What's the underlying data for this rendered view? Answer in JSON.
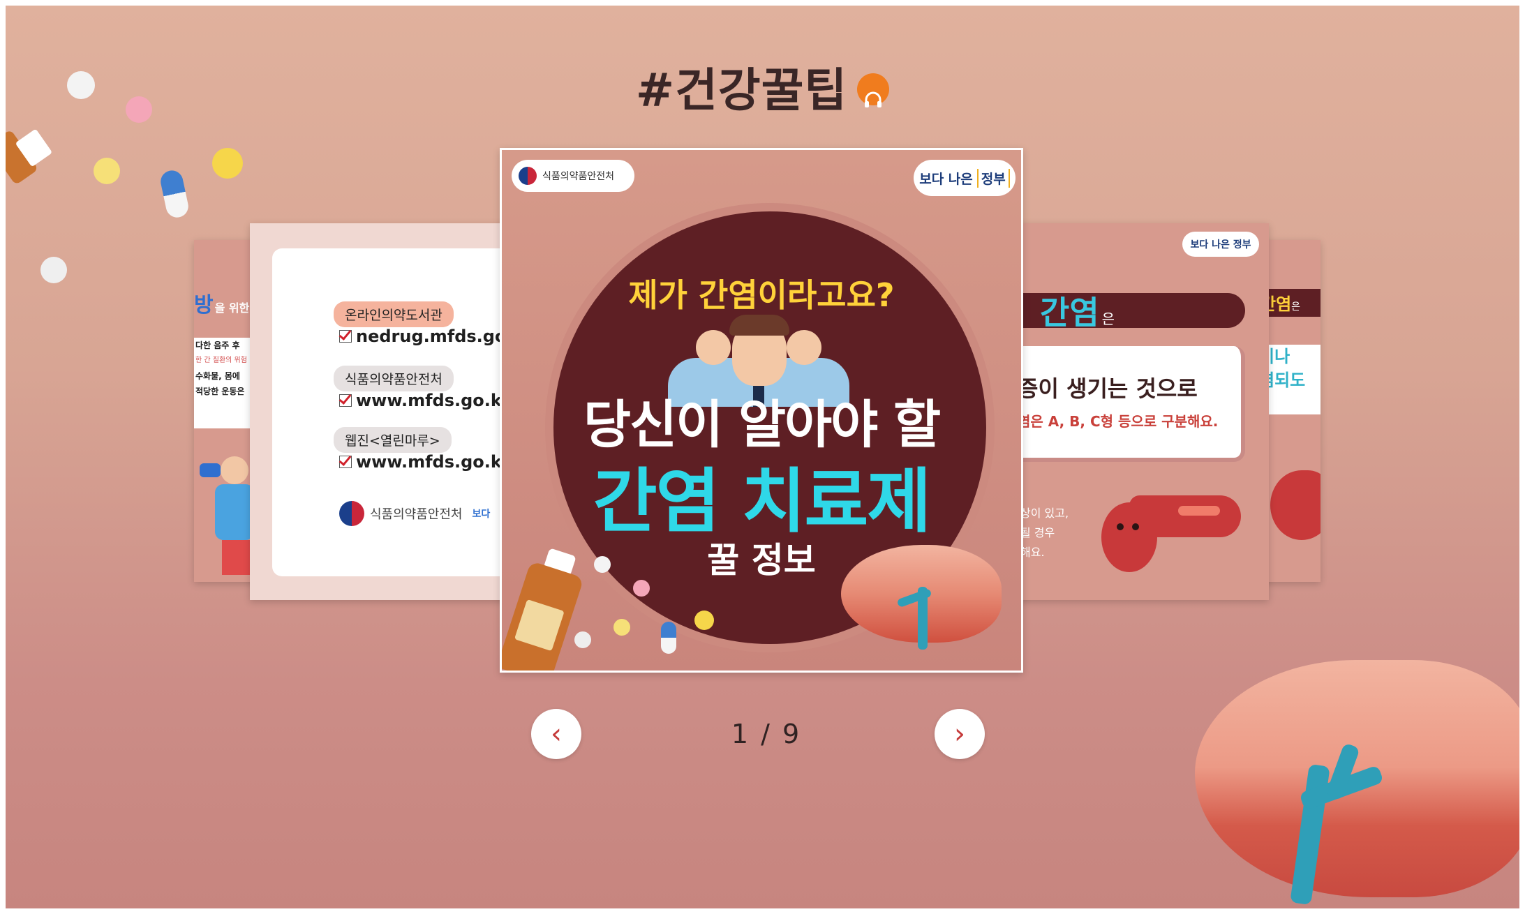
{
  "header": {
    "title": "#건강꿀팁"
  },
  "carousel": {
    "current": 1,
    "total": 9,
    "pager_text": "1 / 9",
    "prev_symbol": "‹",
    "next_symbol": "›",
    "slide_main": {
      "org_name": "식품의약품안전처",
      "badge_top": "보다 나은",
      "badge_bottom": "정부",
      "question": "제가 간염이라고요?",
      "headline_line1": "당신이 알아야 할",
      "headline_line2": "간염 치료제",
      "headline_line3": "꿀 정보"
    },
    "slide_left": {
      "tag1": "온라인의약도서관",
      "link1": "nedrug.mfds.go.kr",
      "tag2": "식품의약품안전처",
      "link2": "www.mfds.go.kr",
      "tag3": "웹진<열린마루>",
      "link3": "www.mfds.go.kr/w",
      "org_name": "식품의약품안전처",
      "badge_partial": "보다"
    },
    "slide_far_left": {
      "heading_highlight": "방",
      "heading_rest": "을 위한",
      "line1": "다한 음주 후",
      "line2": "한 간 질환의 위험",
      "line3": "수화물, 몸에",
      "line4": "적당한 운동은"
    },
    "slide_right": {
      "badge": "보다 나은 정부",
      "heading": "간염",
      "heading_suffix": "은",
      "text1": "증이 생기는 것으로",
      "text2": "염은 A, B, C형 등으로 구분해요.",
      "note1": "상이 있고,",
      "note2": "될 경우",
      "note3": "해요."
    },
    "slide_far_right": {
      "heading": "간염",
      "heading_suffix": "은",
      "line1": "이나",
      "line2": "염되도"
    }
  },
  "colors": {
    "accent_orange": "#f07c1e",
    "circle_bg": "#5e1f24",
    "headline_cyan": "#2fd8e8",
    "question_yellow": "#ffd23a",
    "nav_arrow_red": "#c53a3a"
  }
}
